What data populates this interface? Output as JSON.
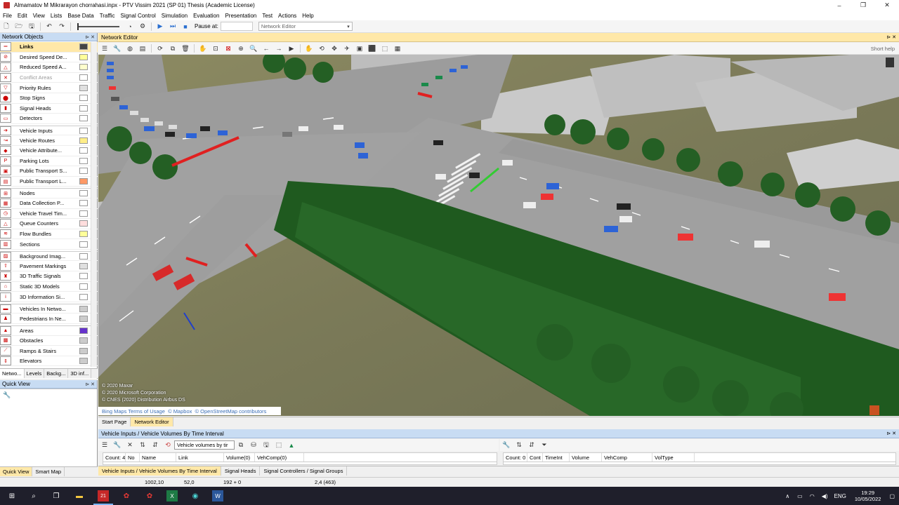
{
  "window": {
    "title": "Almamatov M Mikrarayon chorrahasi.inpx - PTV Vissim 2021 (SP 01) Thesis (Academic License)",
    "minimize": "–",
    "maximize": "❐",
    "close": "✕"
  },
  "menu": [
    "File",
    "Edit",
    "View",
    "Lists",
    "Base Data",
    "Traffic",
    "Signal Control",
    "Simulation",
    "Evaluation",
    "Presentation",
    "Test",
    "Actions",
    "Help"
  ],
  "toolbar": {
    "pause_label": "Pause at:",
    "pause_value": "",
    "editor_select": "Network Editor"
  },
  "network_objects": {
    "title": "Network Objects",
    "pin": "⊳",
    "close": "✕",
    "items": [
      {
        "label": "Links",
        "icon": "links-icon",
        "glyph": "═",
        "color": "#444444",
        "selected": true
      },
      {
        "label": "Desired Speed De...",
        "icon": "speed-icon",
        "glyph": "⊘",
        "color": "#ffff99"
      },
      {
        "label": "Reduced Speed A...",
        "icon": "warning-icon",
        "glyph": "△",
        "color": "#ffffcc"
      },
      {
        "label": "Conflict Areas",
        "icon": "conflict-icon",
        "glyph": "✕",
        "color": "#ffffff",
        "disabled": true
      },
      {
        "label": "Priority Rules",
        "icon": "priority-icon",
        "glyph": "▽",
        "color": "#e0e0e0"
      },
      {
        "label": "Stop Signs",
        "icon": "stop-icon",
        "glyph": "⬤",
        "color": "#ffffff"
      },
      {
        "label": "Signal Heads",
        "icon": "signal-icon",
        "glyph": "▮",
        "color": "#ffffff"
      },
      {
        "label": "Detectors",
        "icon": "detector-icon",
        "glyph": "▭",
        "color": "#ffffff"
      },
      {
        "label": "Vehicle Inputs",
        "icon": "vehicle-input-icon",
        "glyph": "➔",
        "color": "#ffffff",
        "gap": true
      },
      {
        "label": "Vehicle Routes",
        "icon": "route-icon",
        "glyph": "↝",
        "color": "#ffee88"
      },
      {
        "label": "Vehicle Attribute...",
        "icon": "attribute-icon",
        "glyph": "◆",
        "color": "#ffffff"
      },
      {
        "label": "Parking Lots",
        "icon": "parking-icon",
        "glyph": "P",
        "color": "#ffffff"
      },
      {
        "label": "Public Transport S...",
        "icon": "pt-stop-icon",
        "glyph": "▣",
        "color": "#ffffff"
      },
      {
        "label": "Public Transport L...",
        "icon": "pt-line-icon",
        "glyph": "▤",
        "color": "#ff9966"
      },
      {
        "label": "Nodes",
        "icon": "nodes-icon",
        "glyph": "⊞",
        "color": "#ffffff",
        "gap": true
      },
      {
        "label": "Data Collection P...",
        "icon": "data-collection-icon",
        "glyph": "▦",
        "color": "#ffffff"
      },
      {
        "label": "Vehicle Travel Tim...",
        "icon": "travel-time-icon",
        "glyph": "◷",
        "color": "#ffffff"
      },
      {
        "label": "Queue Counters",
        "icon": "queue-icon",
        "glyph": "△",
        "color": "#ffdddd"
      },
      {
        "label": "Flow Bundles",
        "icon": "flow-icon",
        "glyph": "≋",
        "color": "#ffff99"
      },
      {
        "label": "Sections",
        "icon": "sections-icon",
        "glyph": "▥",
        "color": "#ffffff"
      },
      {
        "label": "Background Imag...",
        "icon": "background-icon",
        "glyph": "▨",
        "color": "#ffffff",
        "gap": true
      },
      {
        "label": "Pavement Markings",
        "icon": "pavement-icon",
        "glyph": "⇧",
        "color": "#e0e0e0"
      },
      {
        "label": "3D Traffic Signals",
        "icon": "traffic-signal-icon",
        "glyph": "♜",
        "color": "#ffffff"
      },
      {
        "label": "Static 3D Models",
        "icon": "model-icon",
        "glyph": "⌂",
        "color": "#ffffff"
      },
      {
        "label": "3D Information Si...",
        "icon": "info-sign-icon",
        "glyph": "i",
        "color": "#ffffff"
      },
      {
        "label": "Vehicles In Netwo...",
        "icon": "vehicles-icon",
        "glyph": "▬",
        "color": "#cccccc",
        "gap": true
      },
      {
        "label": "Pedestrians In Ne...",
        "icon": "pedestrian-icon",
        "glyph": "♟",
        "color": "#cccccc"
      },
      {
        "label": "Areas",
        "icon": "areas-icon",
        "glyph": "▲",
        "color": "#6633cc",
        "gap": true
      },
      {
        "label": "Obstacles",
        "icon": "obstacles-icon",
        "glyph": "▩",
        "color": "#cccccc"
      },
      {
        "label": "Ramps & Stairs",
        "icon": "ramps-icon",
        "glyph": "⟋",
        "color": "#cccccc"
      },
      {
        "label": "Elevators",
        "icon": "elevator-icon",
        "glyph": "⇕",
        "color": "#cccccc"
      }
    ],
    "tabs": [
      "Netwo...",
      "Levels",
      "Backg...",
      "3D inf..."
    ]
  },
  "quick_view": {
    "title": "Quick View",
    "tabs": [
      "Quick View",
      "Smart Map"
    ]
  },
  "network_editor": {
    "title": "Network Editor",
    "short_help": "Short help",
    "credits": [
      "© 2020 Maxar",
      "© 2020 Microsoft Corporation",
      "© CNES (2020) Distribution Airbus DS"
    ],
    "bing_terms": "Bing Maps Terms of Usage",
    "mapbox": "© Mapbox",
    "osm": "© OpenStreetMap contributors",
    "tabs": [
      "Start Page",
      "Network Editor"
    ]
  },
  "list": {
    "title": "Vehicle Inputs / Vehicle Volumes By Time Interval",
    "select": "Vehicle volumes by tir",
    "left_columns": [
      "Count: 4",
      "No",
      "Name",
      "Link",
      "Volume(0)",
      "VehComp(0)"
    ],
    "right_columns": [
      "Count: 0",
      "Cont",
      "TimeInt",
      "Volume",
      "VehComp",
      "VolType"
    ],
    "tabs": [
      "Vehicle Inputs / Vehicle Volumes By Time Interval",
      "Signal Heads",
      "Signal Controllers / Signal Groups"
    ]
  },
  "status": {
    "x": "1002,10",
    "y": "52,0",
    "zoom": "192 + 0",
    "step": "2,4 (463)"
  },
  "taskbar": {
    "language": "ENG",
    "time": "19:29",
    "date": "10/05/2022"
  }
}
